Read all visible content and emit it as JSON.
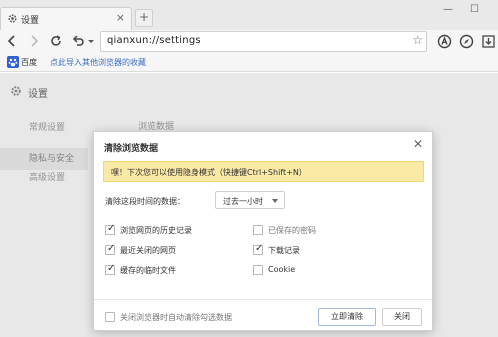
{
  "tab": {
    "title": "设置",
    "close": "×"
  },
  "new_tab": "+",
  "window_controls": {
    "minimize": "—",
    "maximize": "☐"
  },
  "address_bar": {
    "url": "qianxun://settings"
  },
  "bookmarks": {
    "baidu_label": "百度",
    "import_link": "点此导入其他浏览器的收藏"
  },
  "settings": {
    "title": "设置",
    "sidebar": [
      "常规设置",
      "隐私与安全",
      "高级设置"
    ],
    "content_label": "浏览数据"
  },
  "dialog": {
    "title": "清除浏览数据",
    "close": "✕",
    "notice": "嘿！下次您可以使用隐身模式（快捷键Ctrl+Shift+N）",
    "range_label": "清除这段时间的数据：",
    "range_value": "过去一小时",
    "options_left": [
      {
        "label": "浏览网页的历史记录",
        "checked": true
      },
      {
        "label": "最近关闭的网页",
        "checked": true
      },
      {
        "label": "缓存的临时文件",
        "checked": true
      }
    ],
    "options_right": [
      {
        "label": "已保存的密码",
        "checked": false
      },
      {
        "label": "下载记录",
        "checked": true
      },
      {
        "label": "Cookie",
        "checked": false
      }
    ],
    "auto_clear_label": "关闭浏览器时自动清除勾选数据",
    "clear_button": "立即清除",
    "close_button": "关闭"
  },
  "colors": {
    "notice_bg": "#fbe9a6",
    "link": "#3a6fc9",
    "primary_border": "#9fb8dc"
  }
}
